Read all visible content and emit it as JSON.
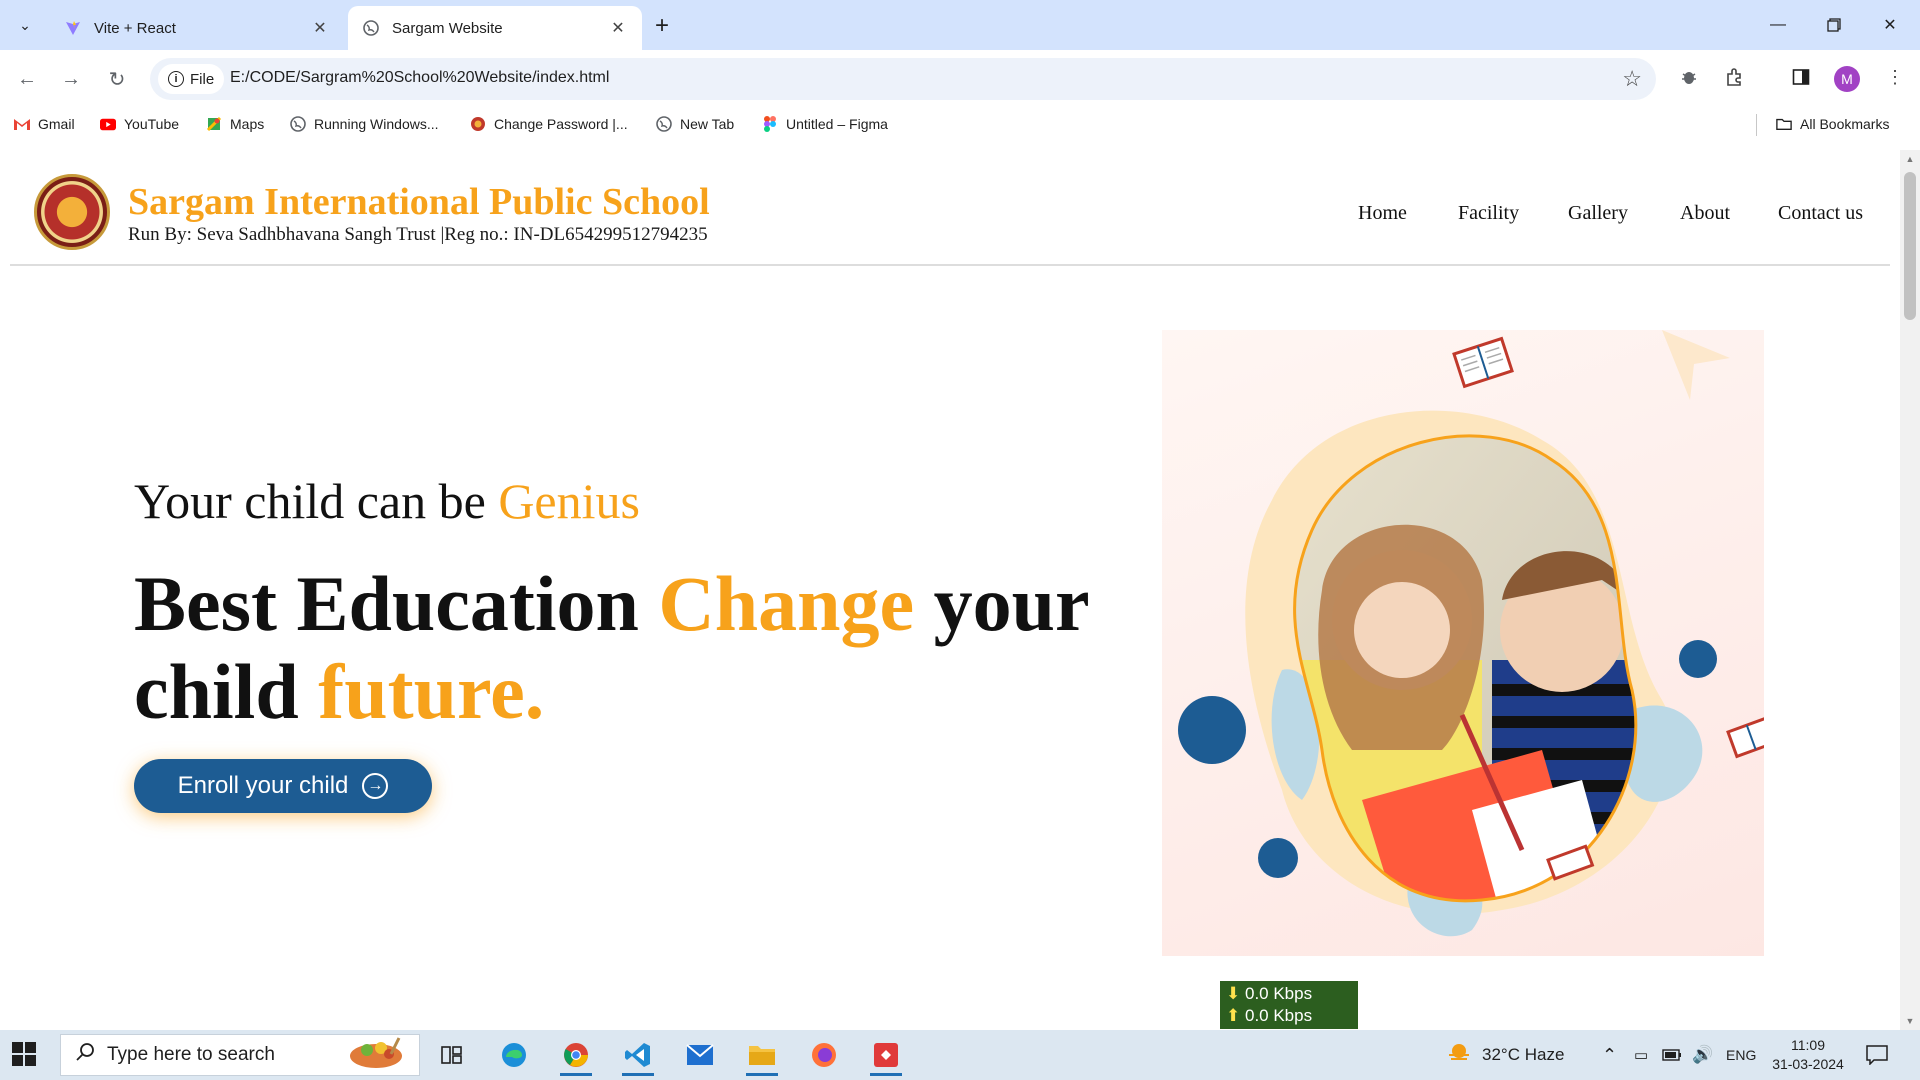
{
  "browser": {
    "tabs": [
      {
        "title": "Vite + React",
        "active": false,
        "favicon": "vite-icon"
      },
      {
        "title": "Sargam Website",
        "active": true,
        "favicon": "globe-icon"
      }
    ],
    "omnibox": {
      "chip_label": "File",
      "url": "E:/CODE/Sargram%20School%20Website/index.html"
    },
    "profile_initial": "M",
    "bookmarks": [
      {
        "label": "Gmail",
        "icon": "gmail-icon"
      },
      {
        "label": "YouTube",
        "icon": "youtube-icon"
      },
      {
        "label": "Maps",
        "icon": "maps-icon"
      },
      {
        "label": "Running Windows...",
        "icon": "globe-icon"
      },
      {
        "label": "Change Password |...",
        "icon": "site-icon"
      },
      {
        "label": "New Tab",
        "icon": "globe-icon"
      },
      {
        "label": "Untitled – Figma",
        "icon": "figma-icon"
      }
    ],
    "all_bookmarks_label": "All Bookmarks"
  },
  "site": {
    "name": "Sargam International Public School",
    "subtitle": "Run By: Seva Sadhbhavana Sangh Trust |Reg no.: IN-DL654299512794235",
    "nav": [
      "Home",
      "Facility",
      "Gallery",
      "About",
      "Contact us"
    ],
    "hero": {
      "line1_plain": "Your child can be ",
      "line1_highlight": "Genius",
      "line2_part1": "Best Education ",
      "line2_highlight1": "Change",
      "line2_part2": " your child ",
      "line2_highlight2": "future."
    },
    "cta_label": "Enroll your child"
  },
  "speed_widget": {
    "down": "0.0 Kbps",
    "up": "0.0 Kbps"
  },
  "taskbar": {
    "search_placeholder": "Type here to search",
    "weather": "32°C  Haze",
    "language": "ENG",
    "time": "11:09",
    "date": "31-03-2024"
  },
  "colors": {
    "accent_orange": "#f7a21b",
    "button_blue": "#1d5c93",
    "tabstrip": "#d3e3fd"
  }
}
